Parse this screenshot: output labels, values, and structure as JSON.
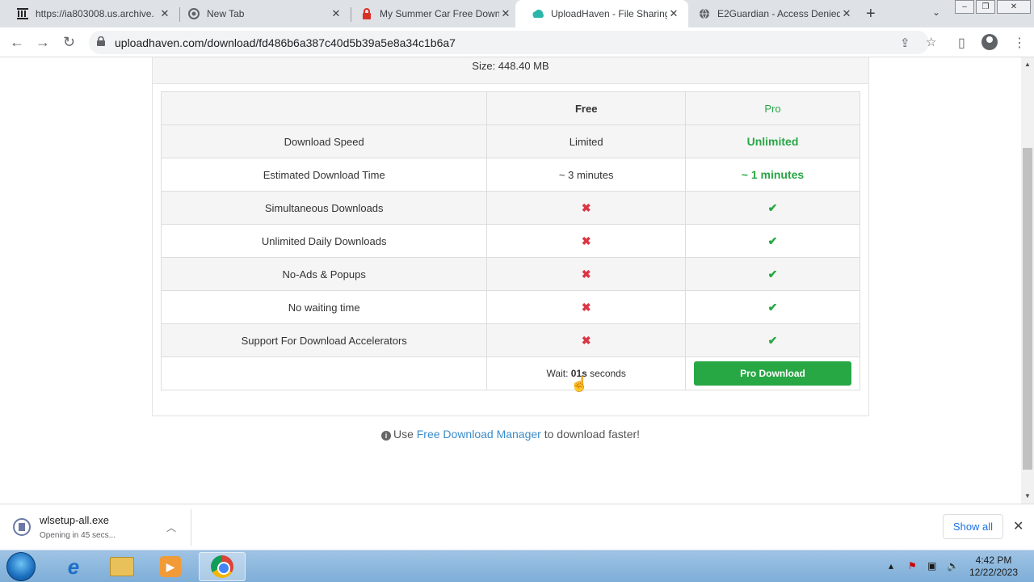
{
  "browser": {
    "tabs": [
      {
        "title": "https://ia803008.us.archive.",
        "icon": "archive-icon"
      },
      {
        "title": "New Tab",
        "icon": "chrome-icon"
      },
      {
        "title": "My Summer Car Free Down",
        "icon": "lock-red-icon"
      },
      {
        "title": "UploadHaven - File Sharing",
        "icon": "uploadhaven-icon"
      },
      {
        "title": "E2Guardian - Access Denied",
        "icon": "globe-icon"
      }
    ],
    "url": "uploadhaven.com/download/fd486b6a387c40d5b39a5e8a34c1b6a7"
  },
  "page": {
    "size_text": "Size: 448.40 MB",
    "table": {
      "headers": [
        "",
        "Free",
        "Pro"
      ],
      "rows": [
        {
          "feature": "Download Speed",
          "free": "Limited",
          "pro": "Unlimited"
        },
        {
          "feature": "Estimated Download Time",
          "free": "~ 3 minutes",
          "pro": "~ 1 minutes"
        },
        {
          "feature": "Simultaneous Downloads",
          "free": "✖",
          "pro": "✔"
        },
        {
          "feature": "Unlimited Daily Downloads",
          "free": "✖",
          "pro": "✔"
        },
        {
          "feature": "No-Ads & Popups",
          "free": "✖",
          "pro": "✔"
        },
        {
          "feature": "No waiting time",
          "free": "✖",
          "pro": "✔"
        },
        {
          "feature": "Support For Download Accelerators",
          "free": "✖",
          "pro": "✔"
        }
      ],
      "wait_prefix": "Wait: ",
      "wait_value": "01s",
      "wait_suffix": " seconds",
      "pro_button": "Pro Download"
    },
    "hint_prefix": "Use ",
    "hint_link": "Free Download Manager",
    "hint_suffix": " to download faster!"
  },
  "download_shelf": {
    "filename": "wlsetup-all.exe",
    "status": "Opening in 45 secs...",
    "show_all": "Show all"
  },
  "taskbar": {
    "time": "4:42 PM",
    "date": "12/22/2023"
  },
  "colors": {
    "pro_green": "#28a745",
    "x_red": "#dc3545",
    "link_blue": "#3b8bc8"
  }
}
